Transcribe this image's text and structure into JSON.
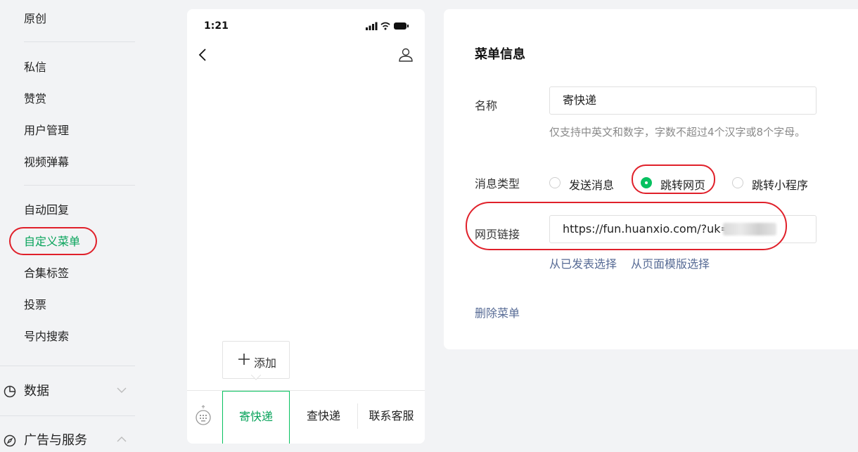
{
  "sidebar": {
    "top_item": "原创",
    "items_a": [
      "私信",
      "赞赏",
      "用户管理",
      "视频弹幕"
    ],
    "items_b": [
      "自动回复",
      "自定义菜单",
      "合集标签",
      "投票",
      "号内搜索"
    ],
    "active_index_b": 1,
    "groups": [
      {
        "label": "数据",
        "icon": "pie-chart-icon",
        "expanded": false
      },
      {
        "label": "广告与服务",
        "icon": "compass-icon",
        "expanded": true
      }
    ]
  },
  "phone": {
    "time": "1:21",
    "add_label": "添加",
    "menu": [
      "寄快递",
      "查快递",
      "联系客服"
    ],
    "selected_menu": 0
  },
  "panel": {
    "title": "菜单信息",
    "name_label": "名称",
    "name_value": "寄快递",
    "name_hint": "仅支持中英文和数字，字数不超过4个汉字或8个字母。",
    "type_label": "消息类型",
    "type_options": [
      "发送消息",
      "跳转网页",
      "跳转小程序"
    ],
    "type_selected": 1,
    "url_label": "网页链接",
    "url_value": "https://fun.huanxio.com/?uk=",
    "url_links": [
      "从已发表选择",
      "从页面模版选择"
    ],
    "delete_label": "删除菜单"
  },
  "colors": {
    "accent": "#07c160",
    "link": "#576b95",
    "annotation": "#e0202a"
  }
}
